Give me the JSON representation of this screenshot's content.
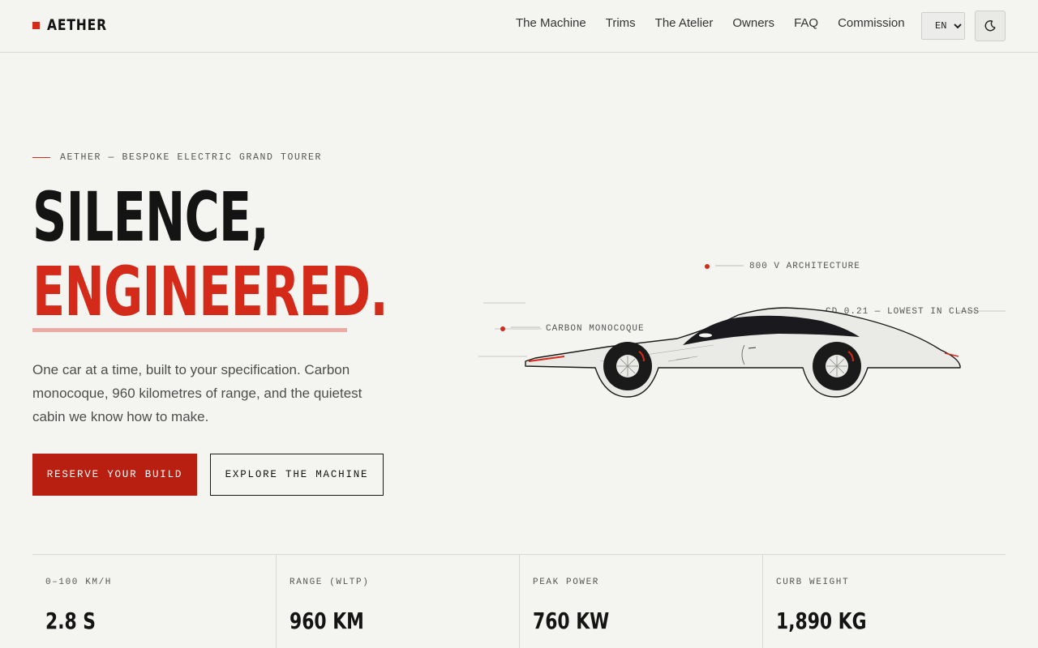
{
  "brand": {
    "name": "AETHER",
    "accent": "#d42a1a"
  },
  "nav": {
    "items": [
      "The Machine",
      "Trims",
      "The Atelier",
      "Owners",
      "FAQ",
      "Commission"
    ],
    "language": "EN",
    "theme_icon": "moon-icon"
  },
  "hero": {
    "eyebrow": "AETHER — BESPOKE ELECTRIC GRAND TOURER",
    "headline_1": "SILENCE,",
    "headline_2": "ENGINEERED.",
    "lead": "One car at a time, built to your specification. Carbon monocoque, 960 kilometres of range, and the quietest cabin we know how to make.",
    "primary_cta": "RESERVE YOUR BUILD",
    "secondary_cta": "EXPLORE THE MACHINE"
  },
  "callouts": {
    "architecture": "800 V ARCHITECTURE",
    "drag": "CD 0.21 — LOWEST IN CLASS",
    "chassis": "CARBON MONOCOQUE"
  },
  "stats": [
    {
      "label": "0–100 KM/H",
      "value": "2.8 S"
    },
    {
      "label": "RANGE (WLTP)",
      "value": "960 KM"
    },
    {
      "label": "PEAK POWER",
      "value": "760 KW"
    },
    {
      "label": "CURB WEIGHT",
      "value": "1,890 KG"
    }
  ]
}
